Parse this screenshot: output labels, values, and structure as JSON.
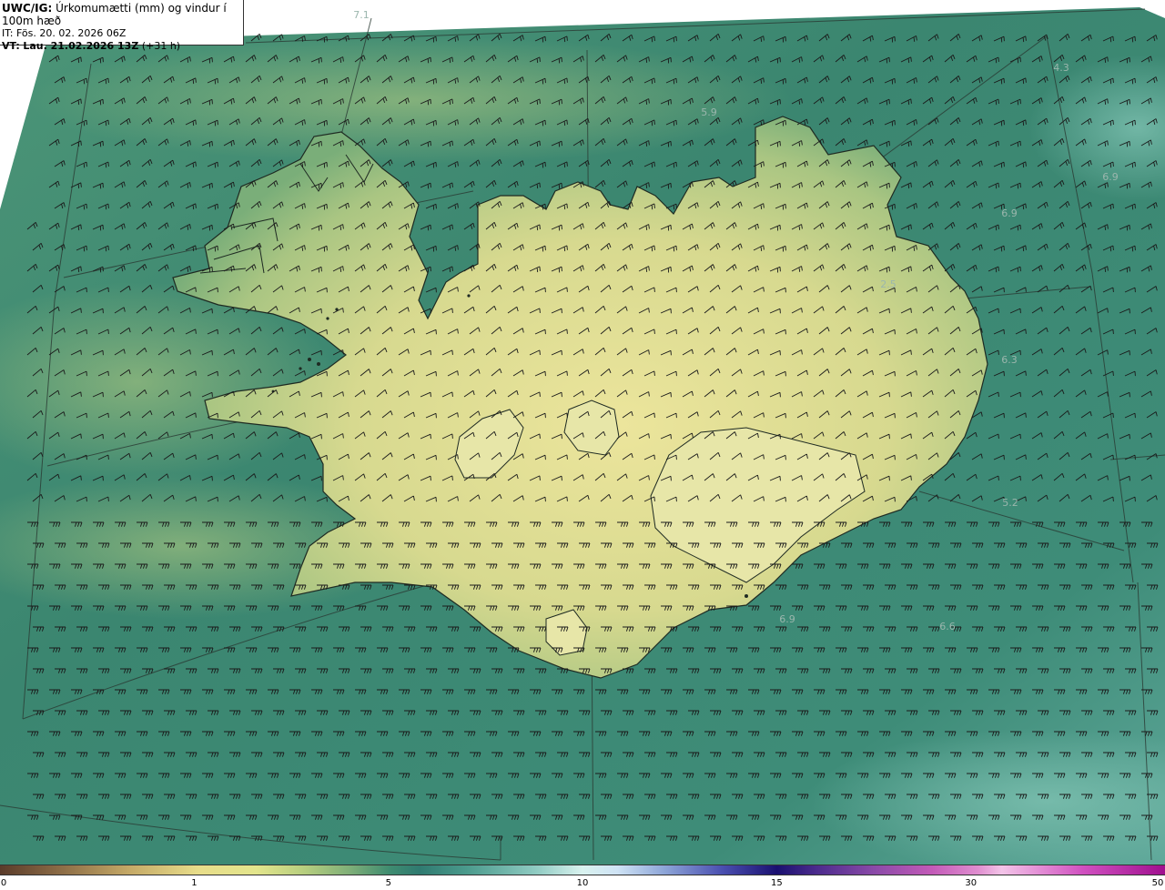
{
  "header": {
    "model": "UWC/IG:",
    "product": "Úrkomumætti (mm) og vindur í 100m hæð",
    "issue_time": "IT: Fös. 20. 02. 2026 06Z",
    "valid_prefix": "VT:",
    "valid_time": "Lau. 21.02.2026 13Z",
    "lead": "(+31 h)"
  },
  "colorbar": {
    "ticks": [
      {
        "label": "0",
        "value": 0,
        "pos": 0.0
      },
      {
        "label": "1",
        "value": 1,
        "pos": 0.1667
      },
      {
        "label": "5",
        "value": 5,
        "pos": 0.3334
      },
      {
        "label": "10",
        "value": 10,
        "pos": 0.5
      },
      {
        "label": "15",
        "value": 15,
        "pos": 0.6667
      },
      {
        "label": "30",
        "value": 30,
        "pos": 0.8334
      },
      {
        "label": "50",
        "value": 50,
        "pos": 1.0
      }
    ]
  },
  "map_labels": [
    {
      "text": "7.1"
    },
    {
      "text": "4.3"
    },
    {
      "text": "5.9"
    },
    {
      "text": "6.9"
    },
    {
      "text": "6.9"
    },
    {
      "text": "2.5"
    },
    {
      "text": "6.3"
    },
    {
      "text": "5.2"
    },
    {
      "text": "6.9"
    },
    {
      "text": "6.6"
    }
  ],
  "colors": {
    "ocean": "#3e8a74",
    "land_low": "#c8d388",
    "land_high": "#e8e39a",
    "coast": "#1e2a22",
    "barb": "#1a1a1a"
  }
}
